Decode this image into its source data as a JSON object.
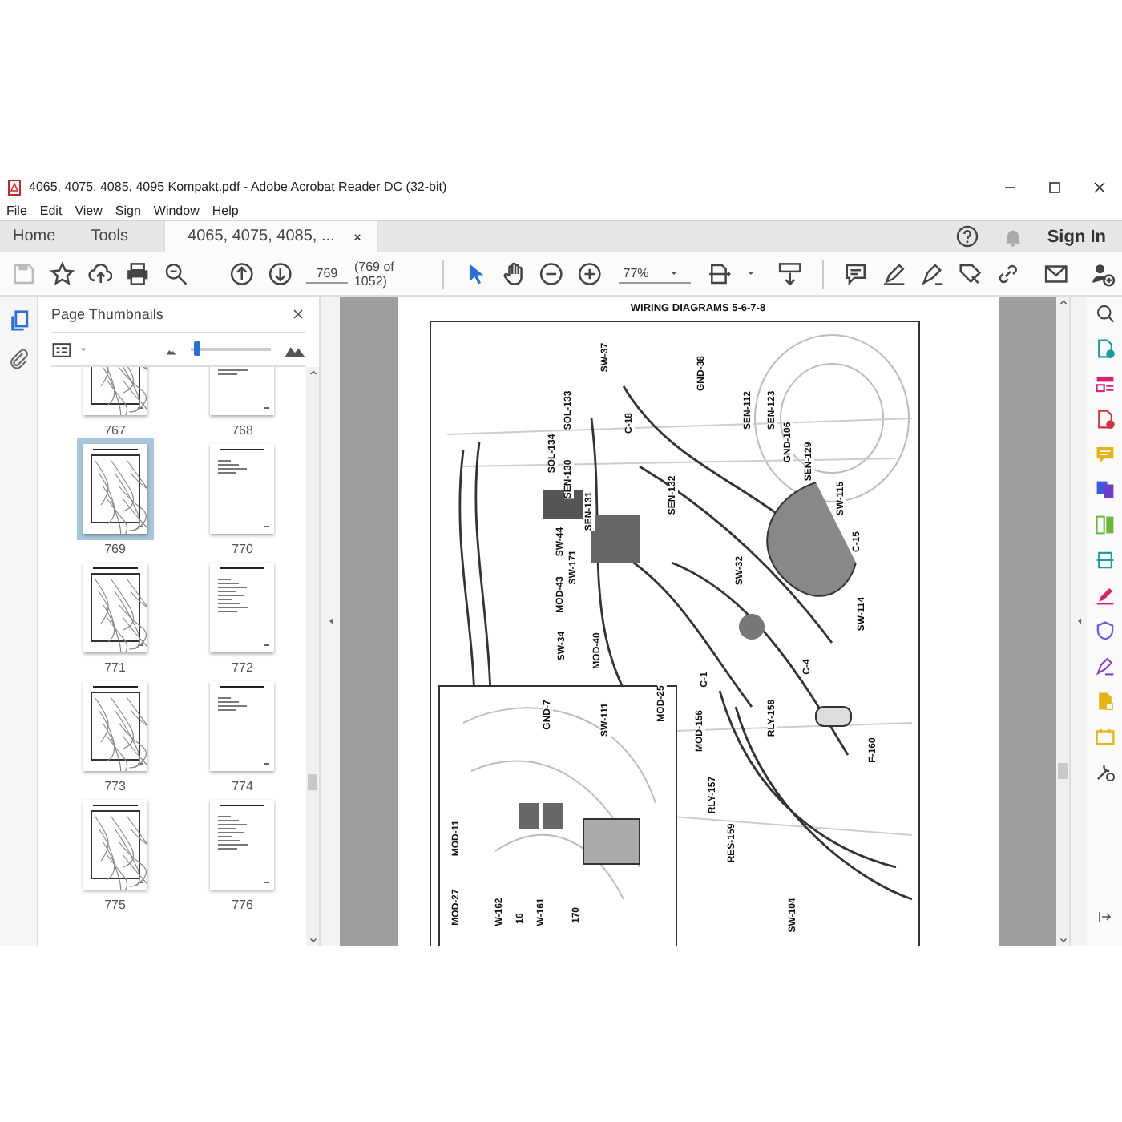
{
  "window": {
    "title": "4065, 4075, 4085, 4095 Kompakt.pdf - Adobe Acrobat Reader DC (32-bit)"
  },
  "menu": [
    "File",
    "Edit",
    "View",
    "Sign",
    "Window",
    "Help"
  ],
  "tabs": [
    {
      "label": "Home",
      "selected": false
    },
    {
      "label": "Tools",
      "selected": false
    },
    {
      "label": "4065, 4075, 4085, ...",
      "selected": true
    }
  ],
  "account": {
    "sign_in": "Sign In"
  },
  "toolbar": {
    "page_number": "769",
    "page_count": "(769 of 1052)",
    "zoom": "77%"
  },
  "thumbnail_panel": {
    "title": "Page Thumbnails",
    "size_slider": {
      "level": 0.08
    },
    "thumbnails": [
      {
        "label": "767",
        "kind": "diagram",
        "selected": false
      },
      {
        "label": "768",
        "kind": "text",
        "selected": false
      },
      {
        "label": "769",
        "kind": "diagram",
        "selected": true
      },
      {
        "label": "770",
        "kind": "text",
        "selected": false
      },
      {
        "label": "771",
        "kind": "diagram",
        "selected": false
      },
      {
        "label": "772",
        "kind": "text",
        "selected": false
      },
      {
        "label": "773",
        "kind": "diagram",
        "selected": false
      },
      {
        "label": "774",
        "kind": "text",
        "selected": false
      },
      {
        "label": "775",
        "kind": "diagram",
        "selected": false
      },
      {
        "label": "776",
        "kind": "text",
        "selected": false
      }
    ]
  },
  "document": {
    "heading": "WIRING DIAGRAMS 5-6-7-8",
    "diagram_labels": [
      "SW-37",
      "GND-38",
      "SOL-133",
      "C-18",
      "SOL-134",
      "SEN-130",
      "SEN-131",
      "SEN-132",
      "SEN-112",
      "SEN-123",
      "GND-106",
      "SEN-129",
      "SW-115",
      "C-15",
      "SW-44",
      "SW-171",
      "SW-32",
      "MOD-43",
      "SW-114",
      "SW-34",
      "MOD-40",
      "C-1",
      "C-4",
      "RLY-158",
      "MOD-156",
      "F-160",
      "RLY-157",
      "RES-159",
      "SW-104",
      "GND-7",
      "SW-111",
      "MOD-25",
      "MOD-11",
      "MOD-27",
      "W-162",
      "16",
      "W-161",
      "170"
    ]
  }
}
